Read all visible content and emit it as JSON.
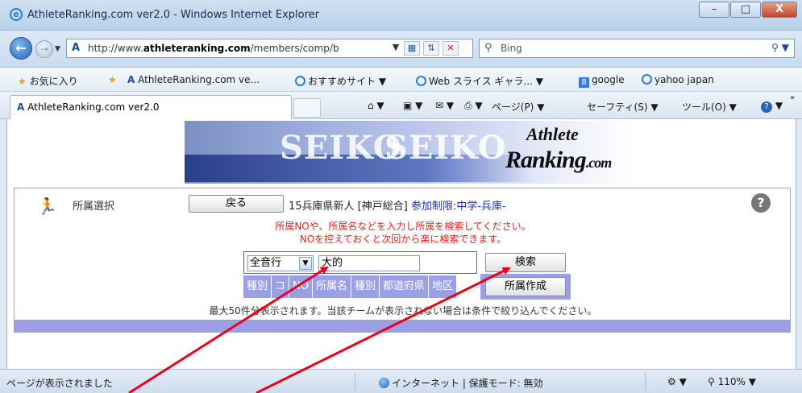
{
  "window": {
    "title": "AthleteRanking.com ver2.0 - Windows Internet Explorer",
    "min": "–",
    "max": "□",
    "close": "X"
  },
  "nav": {
    "url_prefix": "http://www.",
    "url_domain": "athleteranking.com",
    "url_rest": "/members/comp/b",
    "search_placeholder": "Bing"
  },
  "favorites": {
    "label": "お気に入り",
    "items": [
      "AthleteRanking.com ve...",
      "おすすめサイト ▼",
      "Web スライス ギャラ... ▼",
      "google",
      "yahoo japan"
    ]
  },
  "tab": {
    "label": "AthleteRanking.com ver2.0"
  },
  "commands": {
    "page": "ページ(P)",
    "page_key": "P",
    "safety": "セーフティ(S)",
    "tools": "ツール(O)"
  },
  "banner": {
    "logo_line1": "Athlete",
    "logo_line2": "Ranking",
    "logo_suffix": ".com",
    "ad1": "SEIKO",
    "ad2": "SEIKO"
  },
  "panel": {
    "section_label": "所属選択",
    "back_button": "戻る",
    "competition": "15兵庫県新人 [神戸総合]",
    "limit": "参加制限:中学-兵庫-",
    "message1": "所属NOや、所属名などを入力し所属を検索してください。",
    "message2": "NOを控えておくと次回から楽に検索できます。",
    "select_value": "全音行",
    "keyword_value": "大的",
    "search_button": "検索",
    "headers": [
      "種別",
      "コ",
      "NO",
      "所属名",
      "種別",
      "都道府県",
      "地区"
    ],
    "create_button": "所属作成",
    "note": "最大50件分表示されます。当該チームが表示されない場合は条件で絞り込んでください。"
  },
  "status": {
    "text": "ページが表示されました",
    "zone": "インターネット | 保護モード: 無効",
    "zoom": "110%"
  },
  "colors": {
    "header_bg": "#9a9fe6",
    "message": "#e0201a",
    "limit": "#1b2db5",
    "arrow": "#e8001a"
  }
}
